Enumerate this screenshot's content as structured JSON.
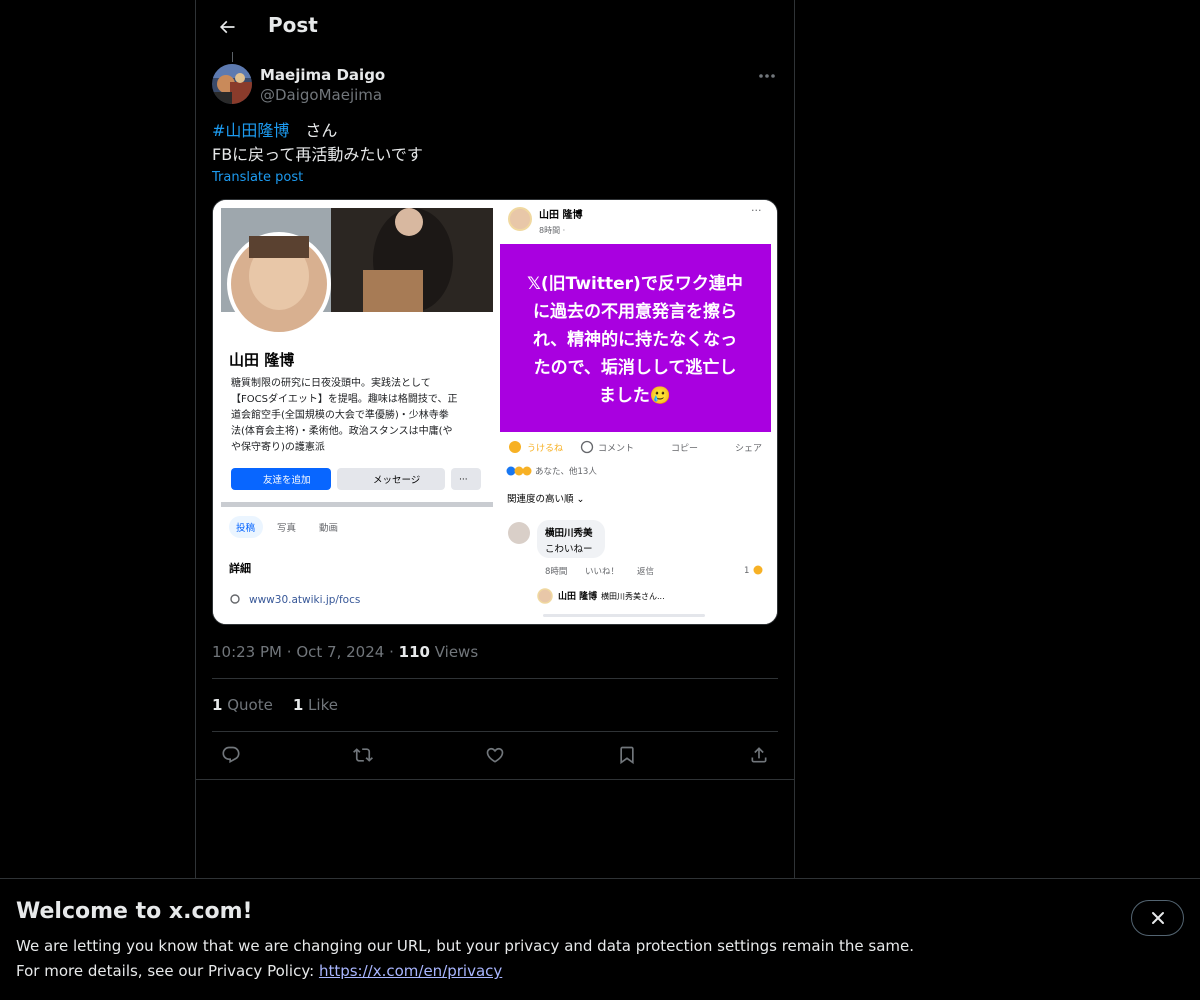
{
  "header": {
    "title": "Post"
  },
  "post": {
    "author": {
      "display_name": "Maejima Daigo",
      "handle": "@DaigoMaejima"
    },
    "text_hashtag": "#山田隆博",
    "text_line1_suffix": "　さん",
    "text_line2": "FBに戻って再活動みたいです",
    "translate_label": "Translate post",
    "time": "10:23 PM",
    "date": "Oct 7, 2024",
    "separator": "·",
    "views_count": "110",
    "views_label": "Views",
    "quote_count": "1",
    "quote_label": "Quote",
    "like_count": "1",
    "like_label": "Like"
  },
  "screenshot": {
    "profile_name": "山田 隆博",
    "bio_lines": [
      "糖質制限の研究に日夜没頭中。実践法として",
      "【FOCSダイエット】を提唱。趣味は格闘技で、正",
      "道会館空手(全国規模の大会で準優勝)・少林寺拳",
      "法(体育会主将)・柔術他。政治スタンスは中庸(や",
      "や保守寄り)の護憲派"
    ],
    "add_friend": "友達を追加",
    "message": "メッセージ",
    "more_dots": "···",
    "tabs": [
      "投稿",
      "写真",
      "動画"
    ],
    "details": "詳細",
    "link": "www30.atwiki.jp/focs",
    "fb_name": "山田 隆博",
    "fb_time": "8時間 · ",
    "fb_post_lines": [
      "𝕏(旧Twitter)で反ワク連中",
      "に過去の不用意発言を擦ら",
      "れ、精神的に持たなくなっ",
      "たので、垢消しして逃亡し",
      "ました🥲"
    ],
    "fb_actions": [
      "うけるね",
      "コメント",
      "コピー",
      "シェア"
    ],
    "fb_reactions": "あなた、他13人",
    "fb_sort": "関連度の高い順 ⌄",
    "commenter": "横田川秀美",
    "comment": "こわいねー",
    "comment_meta": [
      "8時間",
      "いいね！",
      "返信"
    ],
    "comment_reaction_count": "1",
    "reply_name": "山田 隆博",
    "reply_preview": "横田川秀美さん..."
  },
  "banner": {
    "title": "Welcome to x.com!",
    "line1": "We are letting you know that we are changing our URL, but your privacy and data protection settings remain the same.",
    "line2_prefix": "For more details, see our Privacy Policy: ",
    "link": "https://x.com/en/privacy"
  },
  "colors": {
    "accent": "#1d9bf0",
    "fb_purple": "#a900e0",
    "fb_blue": "#0866ff"
  },
  "icons": [
    "back-arrow-icon",
    "more-icon",
    "reply-icon",
    "repost-icon",
    "like-icon",
    "bookmark-icon",
    "share-icon",
    "close-icon"
  ]
}
